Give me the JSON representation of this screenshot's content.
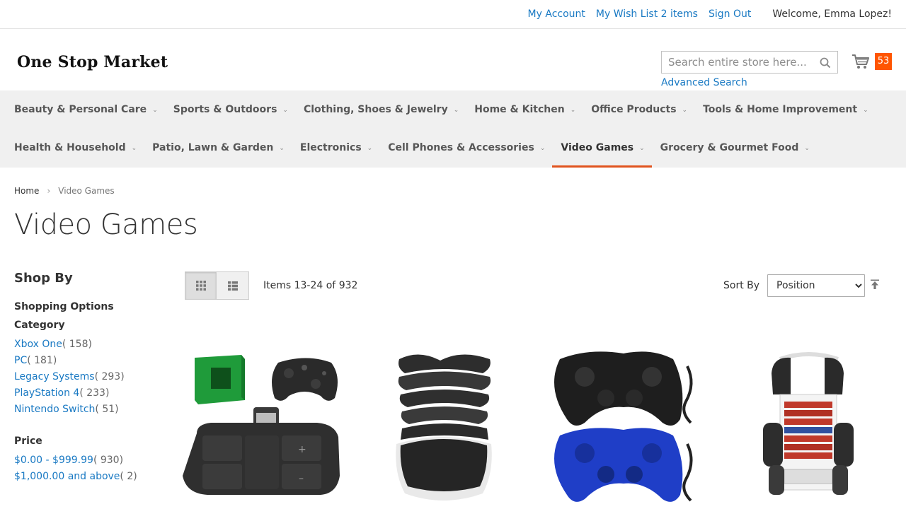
{
  "top_links": {
    "my_account": "My Account",
    "wish_list": "My Wish List 2 items",
    "sign_out": "Sign Out",
    "welcome": "Welcome, Emma Lopez!"
  },
  "header": {
    "logo": "One Stop Market",
    "search_placeholder": "Search entire store here...",
    "advanced_search": "Advanced Search",
    "cart_count": "53"
  },
  "nav": {
    "row1": [
      "Beauty & Personal Care",
      "Sports & Outdoors",
      "Clothing, Shoes & Jewelry",
      "Home & Kitchen",
      "Office Products",
      "Tools & Home Improvement"
    ],
    "row2": [
      "Health & Household",
      "Patio, Lawn & Garden",
      "Electronics",
      "Cell Phones & Accessories",
      "Video Games",
      "Grocery & Gourmet Food"
    ],
    "active": "Video Games"
  },
  "breadcrumb": {
    "home": "Home",
    "current": "Video Games"
  },
  "page_title": "Video Games",
  "sidebar": {
    "shop_by": "Shop By",
    "shopping_options": "Shopping Options",
    "category_title": "Category",
    "categories": [
      {
        "label": "Xbox One",
        "count": "( 158)"
      },
      {
        "label": "PC",
        "count": "( 181)"
      },
      {
        "label": "Legacy Systems",
        "count": "( 293)"
      },
      {
        "label": "PlayStation 4",
        "count": "( 233)"
      },
      {
        "label": "Nintendo Switch",
        "count": "( 51)"
      }
    ],
    "price_title": "Price",
    "prices": [
      {
        "label": "$0.00 - $999.99",
        "count": "( 930)"
      },
      {
        "label": "$1,000.00 and above",
        "count": "( 2)"
      }
    ]
  },
  "toolbar": {
    "items": "Items 13-24 of 932",
    "sort_label": "Sort By",
    "sort_selected": "Position"
  },
  "colors": {
    "link": "#1979c3",
    "accent": "#ff5501",
    "active_nav": "#e0531e"
  }
}
